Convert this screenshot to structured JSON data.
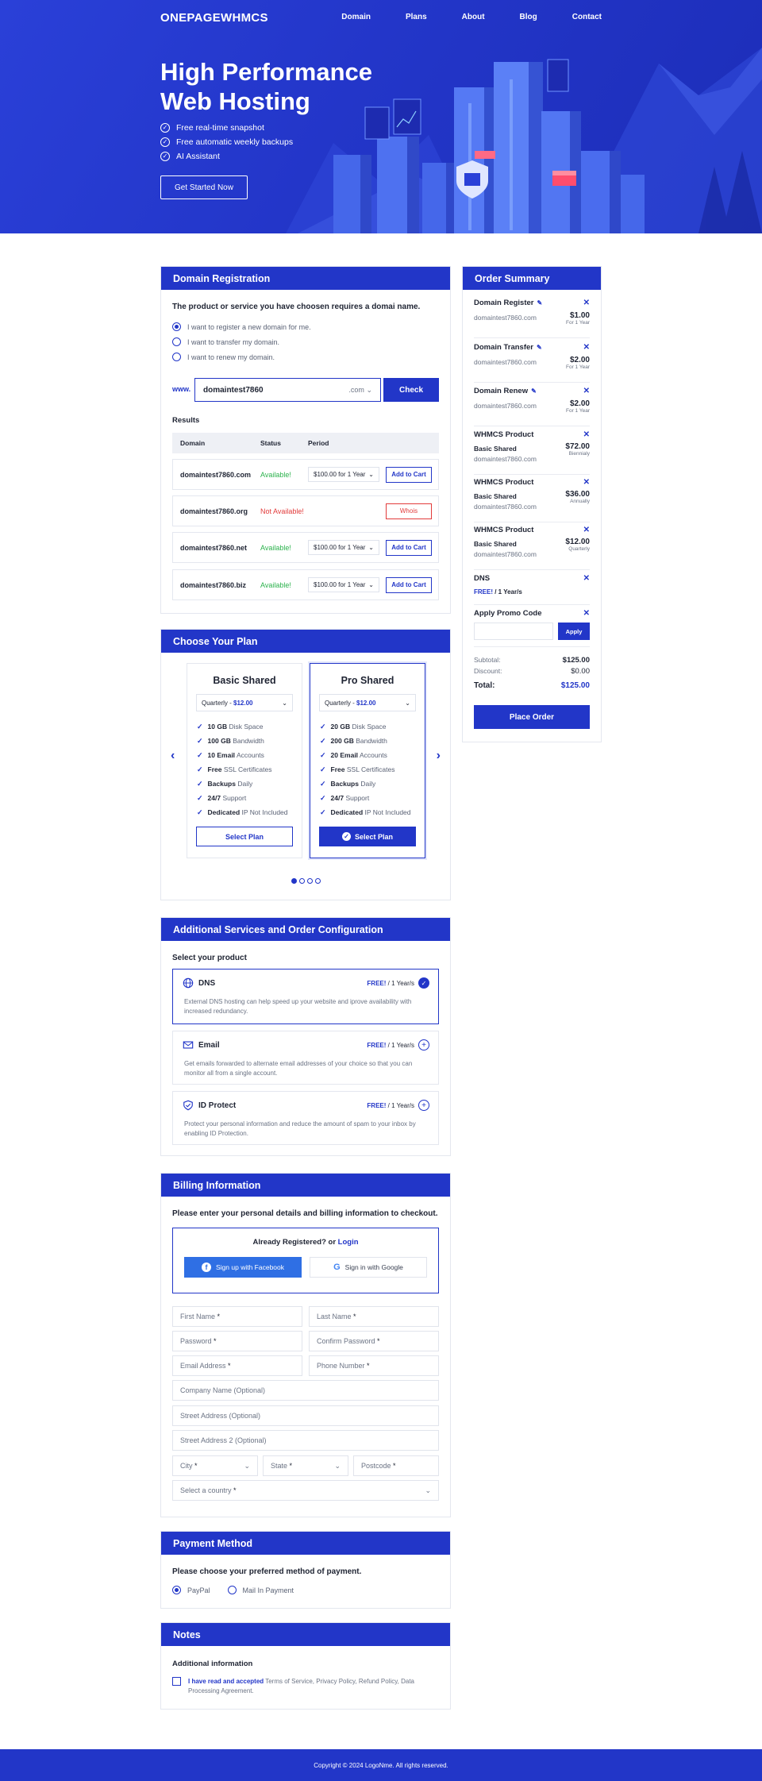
{
  "brand": {
    "logo": "ONEPAGEWHMCS"
  },
  "nav": [
    "Domain",
    "Plans",
    "About",
    "Blog",
    "Contact"
  ],
  "hero": {
    "title_line1": "High Performance",
    "title_line2": "Web Hosting",
    "features": [
      "Free real-time snapshot",
      "Free automatic weekly backups",
      "AI Assistant"
    ],
    "cta": "Get Started Now"
  },
  "domain_registration": {
    "title": "Domain Registration",
    "intro": "The product or service you have choosen requires a domai name.",
    "options": [
      "I want to register a new domain for me.",
      "I want to transfer my domain.",
      "I want to renew my domain."
    ],
    "selected_option": 0,
    "prefix": "www.",
    "input_value": "domaintest7860",
    "tld": ".com",
    "check_label": "Check",
    "results_label": "Results",
    "columns": [
      "Domain",
      "Status",
      "Period"
    ],
    "rows": [
      {
        "domain": "domaintest7860.com",
        "status": "Available!",
        "period": "$100.00 for 1 Year",
        "action": "Add to Cart"
      },
      {
        "domain": "domaintest7860.org",
        "status": "Not Available!",
        "period": "",
        "action": "Whois"
      },
      {
        "domain": "domaintest7860.net",
        "status": "Available!",
        "period": "$100.00 for 1 Year",
        "action": "Add to Cart"
      },
      {
        "domain": "domaintest7860.biz",
        "status": "Available!",
        "period": "$100.00 for 1 Year",
        "action": "Add to Cart"
      }
    ]
  },
  "plans": {
    "title": "Choose Your Plan",
    "items": [
      {
        "name": "Basic Shared",
        "cycle": "Quarterly - ",
        "price": "$12.00",
        "features": [
          [
            "10 GB",
            " Disk Space"
          ],
          [
            "100 GB",
            " Bandwidth"
          ],
          [
            "10 Email",
            " Accounts"
          ],
          [
            "Free",
            " SSL Certificates"
          ],
          [
            "Backups",
            " Daily"
          ],
          [
            "24/7",
            " Support"
          ],
          [
            "Dedicated",
            " IP Not Included"
          ]
        ],
        "button": "Select Plan"
      },
      {
        "name": "Pro Shared",
        "cycle": "Quarterly - ",
        "price": "$12.00",
        "features": [
          [
            "20 GB",
            " Disk Space"
          ],
          [
            "200 GB",
            " Bandwidth"
          ],
          [
            "20 Email",
            " Accounts"
          ],
          [
            "Free",
            " SSL Certificates"
          ],
          [
            "Backups",
            " Daily"
          ],
          [
            "24/7",
            " Support"
          ],
          [
            "Dedicated",
            " IP Not Included"
          ]
        ],
        "button": "Select Plan"
      }
    ],
    "slide_count": 4,
    "active_slide": 0
  },
  "services": {
    "title": "Additional Services and Order Configuration",
    "subtitle": "Select your product",
    "items": [
      {
        "name": "DNS",
        "free": "FREE!",
        "period": " / 1 Year/s",
        "desc": "External DNS hosting can help speed up your website and iprove availability with increased redundancy.",
        "selected": true
      },
      {
        "name": "Email",
        "free": "FREE!",
        "period": " / 1 Year/s",
        "desc": "Get emails forwarded to alternate email addresses of your choice so that you can monitor all from a single account.",
        "selected": false
      },
      {
        "name": "ID Protect",
        "free": "FREE!",
        "period": " / 1 Year/s",
        "desc": "Protect your personal information and reduce the amount of spam to your inbox by enabling ID Protection.",
        "selected": false
      }
    ]
  },
  "billing": {
    "title": "Billing Information",
    "intro": "Please enter your personal details and billing information to checkout.",
    "registered": "Already Registered? or ",
    "login": "Login",
    "facebook": "Sign up with Facebook",
    "google": "Sign in with Google",
    "fields": {
      "first_name": "First Name",
      "last_name": "Last Name",
      "password": "Password",
      "confirm_password": "Confirm Password",
      "email": "Email Address",
      "phone": "Phone Number",
      "company": "Company Name (Optional)",
      "street": "Street Address (Optional)",
      "street2": "Street Address 2 (Optional)",
      "city": "City",
      "state": "State",
      "postcode": "Postcode",
      "country": "Select a country"
    },
    "required_mark": " *"
  },
  "payment": {
    "title": "Payment Method",
    "intro": "Please choose your preferred method of payment.",
    "options": [
      "PayPal",
      "Mail In Payment"
    ],
    "selected": 0
  },
  "notes": {
    "title": "Notes",
    "subtitle": "Additional information",
    "accept": "I have read and accepted",
    "terms": " Terms of Service, Privacy Policy, Refund Policy, Data Processing Agreement."
  },
  "order_summary": {
    "title": "Order Summary",
    "items": [
      {
        "title": "Domain Register",
        "line1": "domaintest7860.com",
        "line2": "",
        "price": "$1.00",
        "note": "For 1 Year",
        "editable": true
      },
      {
        "title": "Domain Transfer",
        "line1": "domaintest7860.com",
        "line2": "",
        "price": "$2.00",
        "note": "For 1 Year",
        "editable": true
      },
      {
        "title": "Domain Renew",
        "line1": "domaintest7860.com",
        "line2": "",
        "price": "$2.00",
        "note": "For 1 Year",
        "editable": true
      },
      {
        "title": "WHMCS Product",
        "line1": "Basic Shared",
        "line2": "domaintest7860.com",
        "price": "$72.00",
        "note": "Biennialy",
        "editable": false
      },
      {
        "title": "WHMCS Product",
        "line1": "Basic Shared",
        "line2": "domaintest7860.com",
        "price": "$36.00",
        "note": "Annually",
        "editable": false
      },
      {
        "title": "WHMCS Product",
        "line1": "Basic Shared",
        "line2": "domaintest7860.com",
        "price": "$12.00",
        "note": "Quarterly",
        "editable": false
      }
    ],
    "dns": {
      "title": "DNS",
      "free": "FREE!",
      "period": " / 1 Year/s"
    },
    "promo_title": "Apply Promo Code",
    "apply": "Apply",
    "subtotal_label": "Subtotal:",
    "subtotal": "$125.00",
    "discount_label": "Discount:",
    "discount": "$0.00",
    "total_label": "Total:",
    "total": "$125.00",
    "place_order": "Place Order"
  },
  "footer": "Copyright © 2024 LogoNme. All rights reserved.",
  "colors": {
    "primary": "#2236c8",
    "available": "#2bb24c",
    "unavailable": "#e23b3b",
    "facebook": "#2f6fe4"
  }
}
